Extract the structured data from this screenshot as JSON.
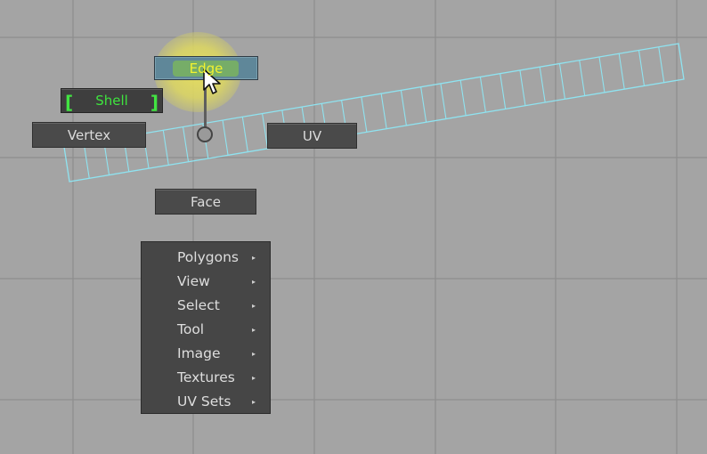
{
  "colors": {
    "viewport_bg": "#a4a4a4",
    "grid_line": "#8e8e8e",
    "uv_wire": "#8fe3f0",
    "edge_label": "#f2f230",
    "shell_label": "#3ee43e"
  },
  "marking_menu": {
    "edge": "Edge",
    "shell": "Shell",
    "vertex": "Vertex",
    "uv": "UV",
    "face": "Face"
  },
  "context_menu": {
    "items": [
      {
        "label": "Polygons",
        "has_submenu": true
      },
      {
        "label": "View",
        "has_submenu": true
      },
      {
        "label": "Select",
        "has_submenu": true
      },
      {
        "label": "Tool",
        "has_submenu": true
      },
      {
        "label": "Image",
        "has_submenu": true
      },
      {
        "label": "Textures",
        "has_submenu": true
      },
      {
        "label": "UV Sets",
        "has_submenu": true
      }
    ],
    "submenu_arrow": "▸"
  },
  "icons": {
    "cursor": "arrow-cursor-icon"
  }
}
